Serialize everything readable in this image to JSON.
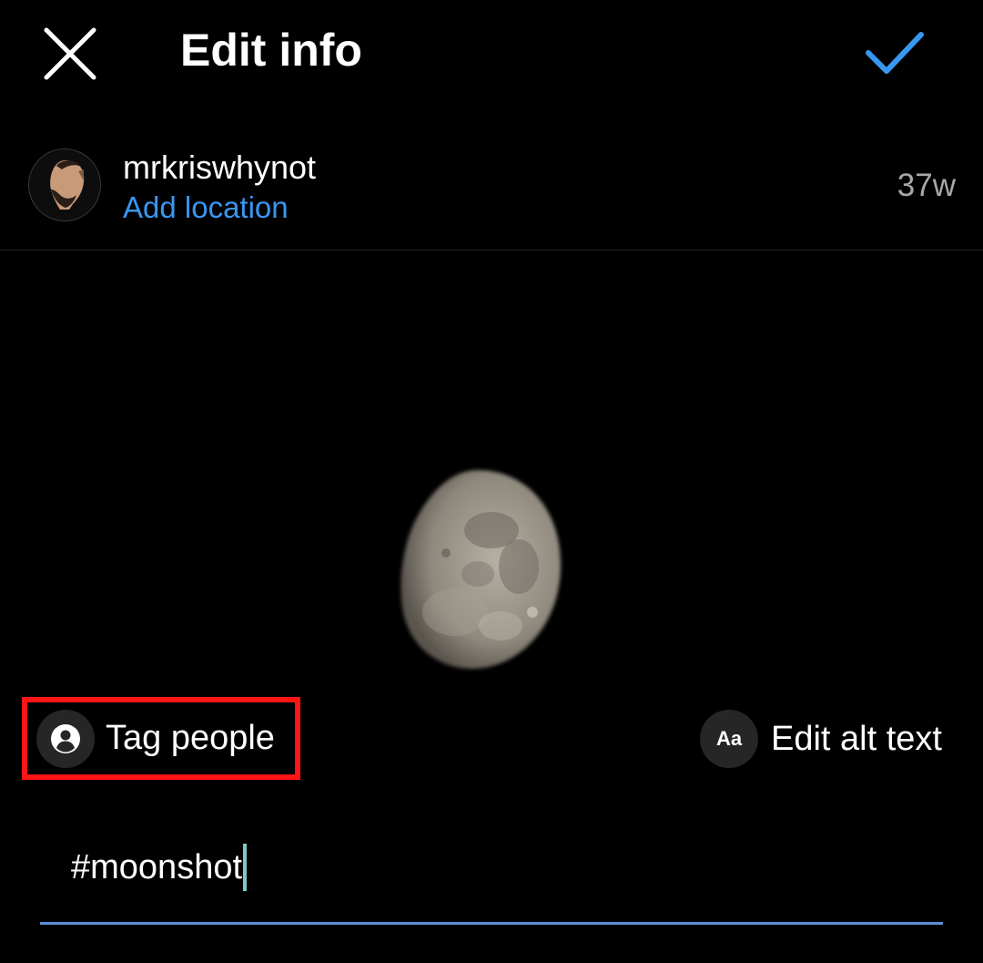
{
  "header": {
    "title": "Edit info",
    "close_icon": "close-icon",
    "done_icon": "checkmark-icon",
    "accent_color": "#3897f0"
  },
  "post": {
    "username": "mrkriswhynot",
    "location_link": "Add location",
    "timestamp": "37w",
    "avatar_icon": "profile-avatar"
  },
  "actions": {
    "tag_people": {
      "label": "Tag people",
      "icon": "person-circle-icon",
      "highlight_color": "#ff1414"
    },
    "alt_text": {
      "label": "Edit alt text",
      "icon_text": "Aa"
    }
  },
  "caption": {
    "value": "#moonshot"
  }
}
